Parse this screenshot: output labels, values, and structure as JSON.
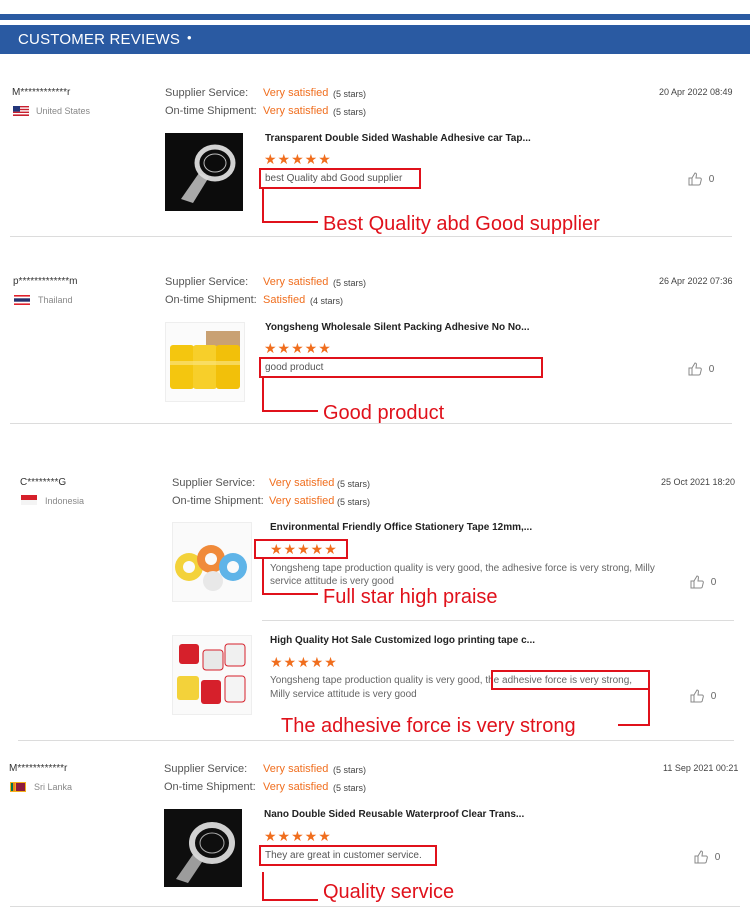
{
  "header": {
    "title": "CUSTOMER REVIEWS",
    "dot": "•"
  },
  "labels": {
    "supplier": "Supplier Service:",
    "shipment": "On-time Shipment:"
  },
  "reviews": [
    {
      "user": "M************r",
      "country": "United States",
      "supplier_rating": "Very satisfied",
      "supplier_stars": "(5 stars)",
      "shipment_rating": "Very satisfied",
      "shipment_stars": "(5 stars)",
      "date": "20 Apr 2022 08:49",
      "items": [
        {
          "title": "Transparent Double Sided Washable Adhesive car Tap...",
          "stars": "★★★★★",
          "text": "best Quality abd Good supplier",
          "likes": "0",
          "annotation": "Best Quality abd Good supplier"
        }
      ]
    },
    {
      "user": "p*************m",
      "country": "Thailand",
      "supplier_rating": "Very satisfied",
      "supplier_stars": "(5 stars)",
      "shipment_rating": "Satisfied",
      "shipment_stars": "(4 stars)",
      "date": "26 Apr 2022 07:36",
      "items": [
        {
          "title": "Yongsheng Wholesale Silent Packing Adhesive No No...",
          "stars": "★★★★★",
          "text": "good product",
          "likes": "0",
          "annotation": "Good product"
        }
      ]
    },
    {
      "user": "C********G",
      "country": "Indonesia",
      "supplier_rating": "Very satisfied",
      "supplier_stars": "(5 stars)",
      "shipment_rating": "Very satisfied",
      "shipment_stars": "(5 stars)",
      "date": "25 Oct 2021 18:20",
      "items": [
        {
          "title": "Environmental Friendly Office Stationery Tape 12mm,...",
          "stars": "★★★★★",
          "text": "Yongsheng tape production quality is very good, the adhesive force is very strong, Milly service attitude is very good",
          "likes": "0",
          "annotation": "Full star high praise"
        },
        {
          "title": "High Quality Hot Sale Customized logo printing tape c...",
          "stars": "★★★★★",
          "text_a": "Yongsheng tape production quality is very good, ",
          "text_b": "the adhesive force is very strong,",
          "text_c": "Milly service attitude is very good",
          "likes": "0",
          "annotation": "The adhesive force is very strong"
        }
      ]
    },
    {
      "user": "M************r",
      "country": "Sri Lanka",
      "supplier_rating": "Very satisfied",
      "supplier_stars": "(5 stars)",
      "shipment_rating": "Very satisfied",
      "shipment_stars": "(5 stars)",
      "date": "11 Sep 2021 00:21",
      "items": [
        {
          "title": "Nano Double Sided Reusable Waterproof Clear Trans...",
          "stars": "★★★★★",
          "text": "They are great in customer service.",
          "likes": "0",
          "annotation": "Quality service"
        }
      ]
    }
  ],
  "colors": {
    "header_blue": "#2a5aa2",
    "accent_orange": "#f06e1e",
    "annotation_red": "#e0111b"
  },
  "icons": {
    "like": "thumbs-up-icon"
  }
}
